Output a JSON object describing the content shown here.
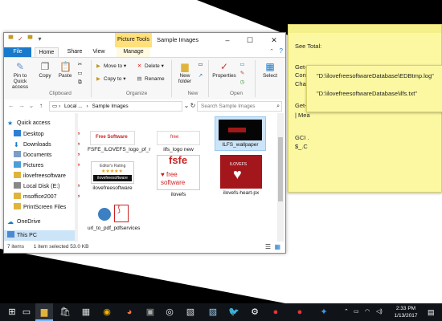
{
  "window": {
    "contextual_tab": "Picture Tools",
    "title": "Sample Images",
    "tabs": [
      "File",
      "Home",
      "Share",
      "View",
      "Manage"
    ]
  },
  "ribbon": {
    "pin_label": "Pin to Quick access",
    "copy_label": "Copy",
    "paste_label": "Paste",
    "move_to": "Move to",
    "copy_to": "Copy to",
    "delete": "Delete",
    "rename": "Rename",
    "new_folder": "New folder",
    "properties": "Properties",
    "select": "Select",
    "groups": [
      "Clipboard",
      "Organize",
      "New",
      "Open"
    ]
  },
  "address": {
    "path_root": "Local ...",
    "path_folder": "Sample Images",
    "search_placeholder": "Search Sample Images"
  },
  "sidebar": {
    "items": [
      {
        "label": "Quick access",
        "icon": "star-icon"
      },
      {
        "label": "Desktop",
        "icon": "desktop-icon"
      },
      {
        "label": "Downloads",
        "icon": "download-icon"
      },
      {
        "label": "Documents",
        "icon": "documents-icon"
      },
      {
        "label": "Pictures",
        "icon": "pictures-icon"
      },
      {
        "label": "ilovefreesoftware",
        "icon": "folder-icon"
      },
      {
        "label": "Local Disk (E:)",
        "icon": "drive-icon"
      },
      {
        "label": "msoffice2007",
        "icon": "folder-icon"
      },
      {
        "label": "PrintScreen Files",
        "icon": "folder-icon"
      },
      {
        "label": "OneDrive",
        "icon": "cloud-icon"
      },
      {
        "label": "This PC",
        "icon": "computer-icon"
      }
    ]
  },
  "files": [
    {
      "name": "FSFE_ILOVEFS_logo_pf_r",
      "thumb_text": "Free Software"
    },
    {
      "name": "ilfs_logo new",
      "thumb_text": "free"
    },
    {
      "name": "ILFS_wallpaper",
      "thumb_text": ""
    },
    {
      "name": "ilovefreesoftware",
      "thumb_text": "Editor's Rating"
    },
    {
      "name": "ilovefs",
      "thumb_text": "fsfe"
    },
    {
      "name": "ilovefs-heart-px",
      "thumb_text": "ILOVEFS"
    },
    {
      "name": "url_to_pdf_pdfservices",
      "thumb_text": ""
    }
  ],
  "status": {
    "item_count": "7 items",
    "selection": "1 item selected  53.0 KB"
  },
  "sticky_note": {
    "lines": [
      "See Total:",
      "Get-C",
      "Cont",
      "Chara",
      "Get-C",
      "| Mea",
      "GCI .",
      "$_.C"
    ]
  },
  "sticky_note_2": {
    "lines": [
      "\"D:\\ilovefreesoftwareDatabase\\EDBtmp.log\"",
      "\"D:\\ilovefreesoftwareDatabase\\ilfs.txt\""
    ]
  },
  "taskbar": {
    "icons": [
      "windows-icon",
      "task-view-icon",
      "file-explorer-icon",
      "store-icon",
      "calendar-icon",
      "chrome-icon",
      "firefox-icon",
      "media-icon",
      "capture-icon",
      "image-icon",
      "twitter-icon",
      "settings-icon",
      "app-icon",
      "app-icon-2",
      "app-icon-3"
    ],
    "time": "2:33 PM",
    "date": "1/13/2017"
  },
  "colors": {
    "accent": "#1979ca",
    "sticky": "#fcf8a2",
    "contextual": "#ffe07a"
  }
}
